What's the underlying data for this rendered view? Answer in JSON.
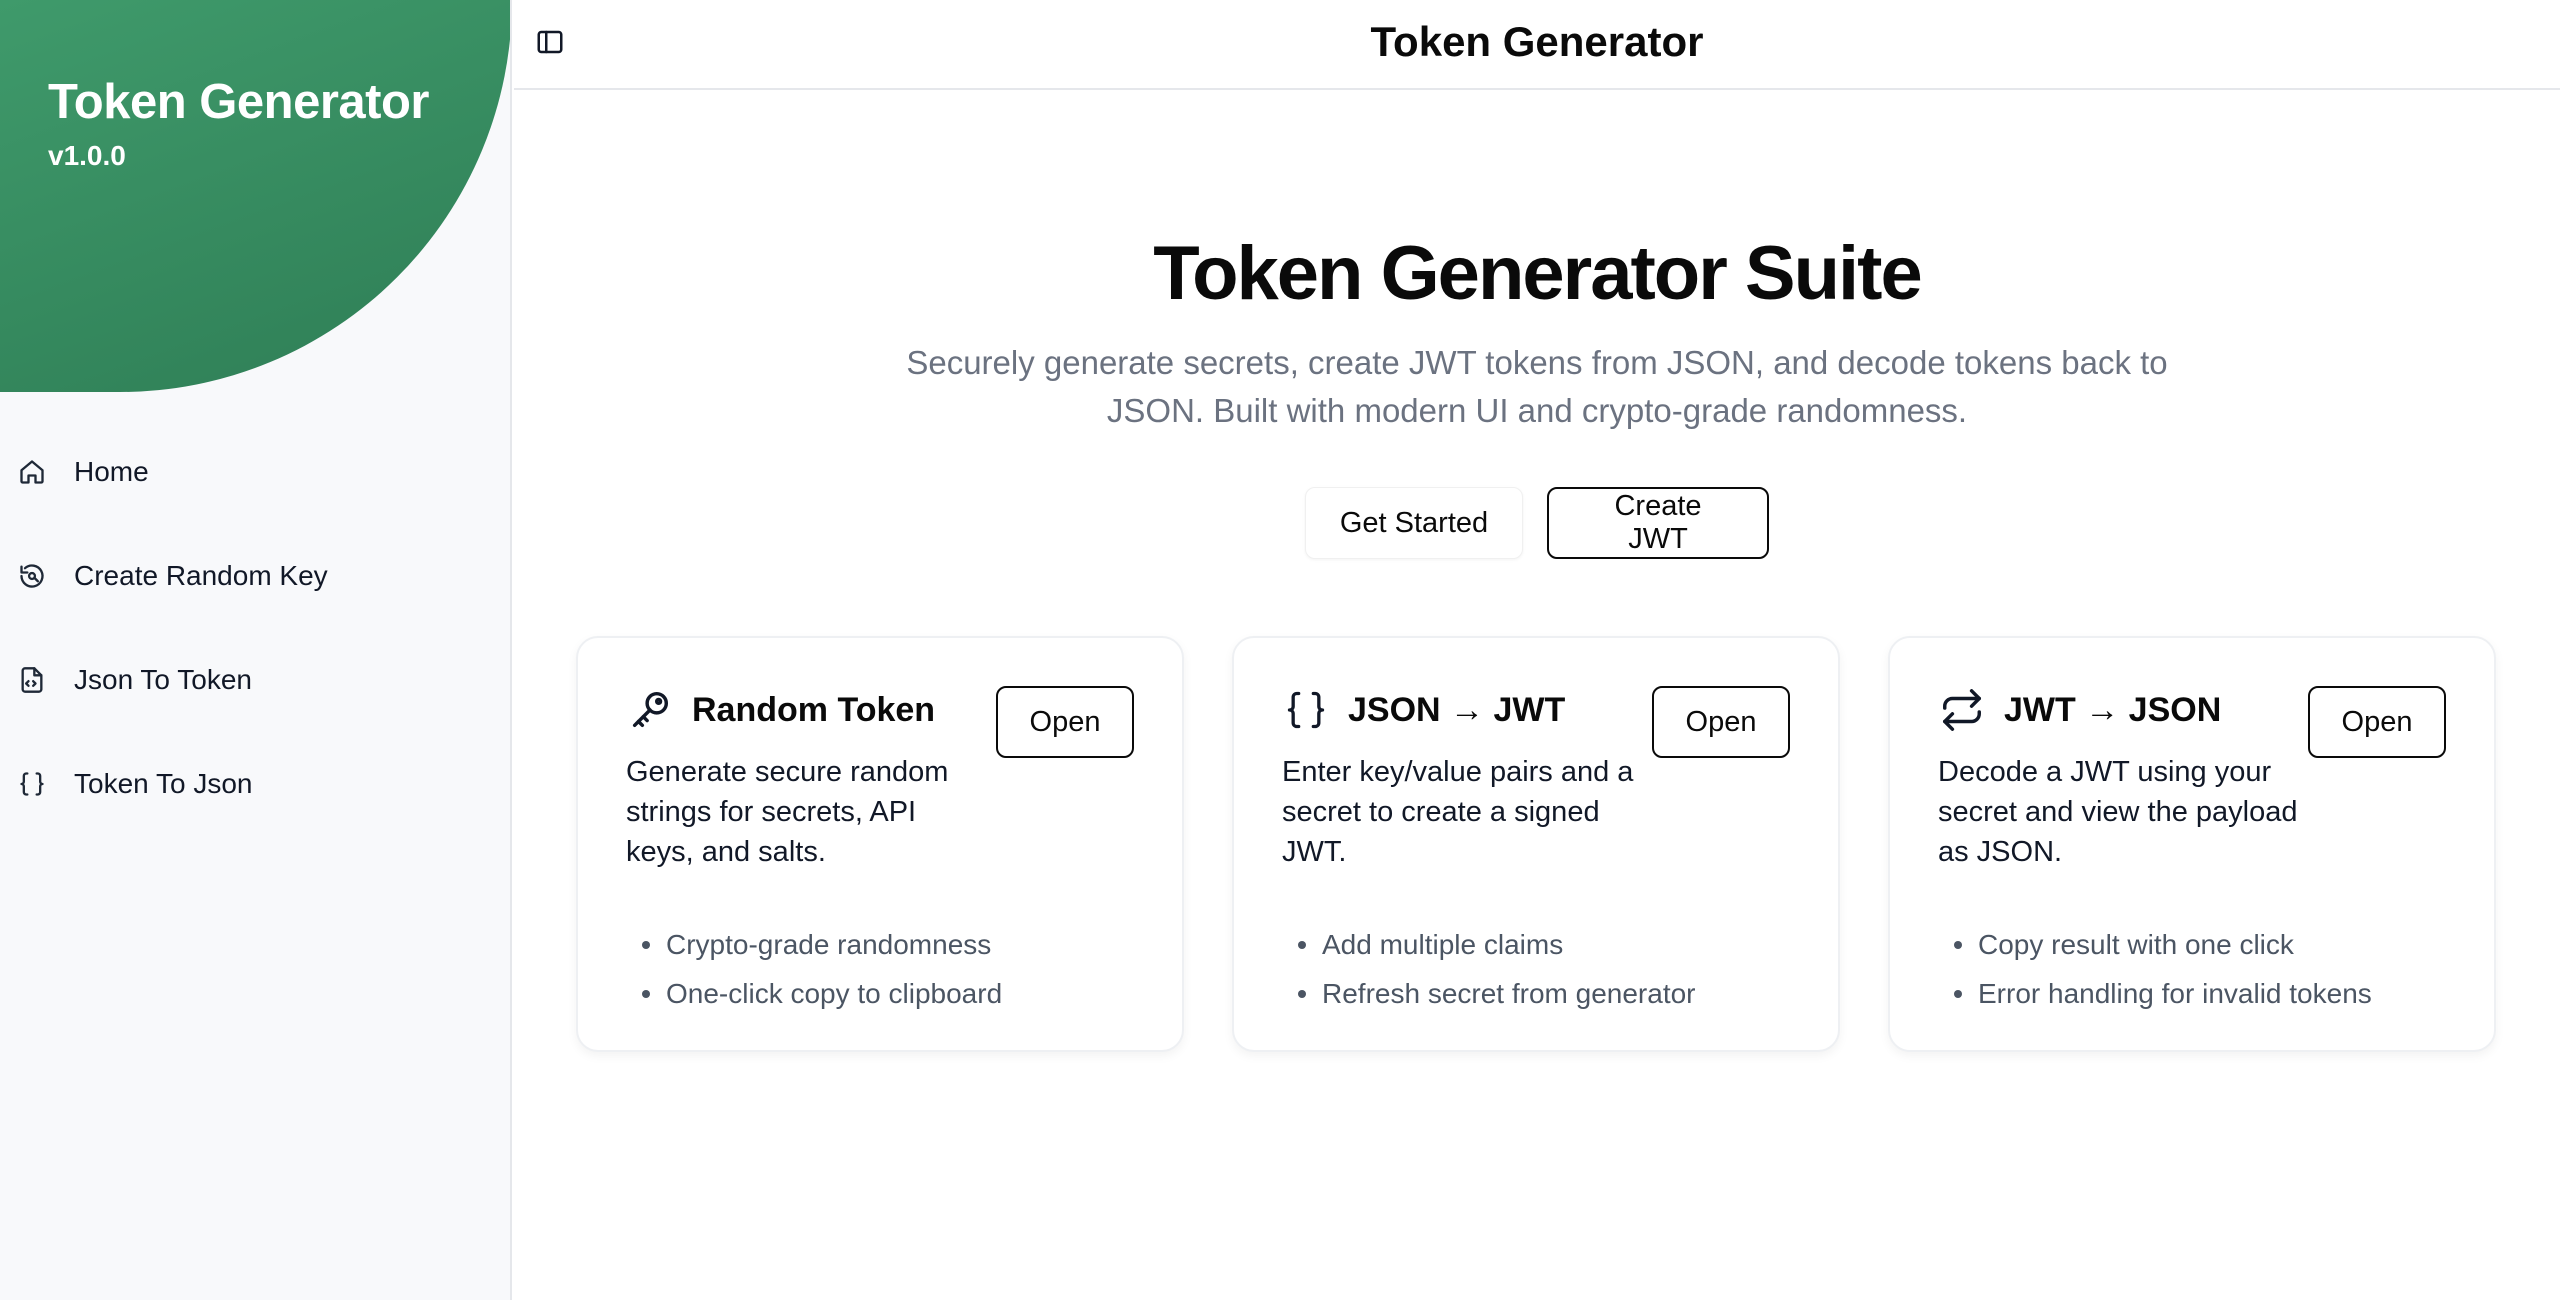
{
  "sidebar": {
    "brand_title": "Token Generator",
    "brand_version": "v1.0.0",
    "brand_color": "#3f9a6b",
    "items": [
      {
        "label": "Home",
        "icon": "home-icon"
      },
      {
        "label": "Create Random Key",
        "icon": "refresh-key-icon"
      },
      {
        "label": "Json To Token",
        "icon": "file-json-icon"
      },
      {
        "label": "Token To Json",
        "icon": "braces-icon"
      }
    ]
  },
  "header": {
    "title": "Token Generator",
    "toggle_icon": "sidebar-toggle-icon"
  },
  "hero": {
    "title": "Token Generator Suite",
    "subtitle": "Securely generate secrets, create JWT tokens from JSON, and decode tokens back to JSON. Built with modern UI and crypto-grade randomness.",
    "primary_label": "Get Started",
    "secondary_label": "Create JWT"
  },
  "cards": [
    {
      "icon": "key-icon",
      "title": "Random Token",
      "description": "Generate secure random strings for secrets, API keys, and salts.",
      "open_label": "Open",
      "features": [
        "Crypto-grade randomness",
        "One-click copy to clipboard"
      ]
    },
    {
      "icon": "braces-icon",
      "title": "JSON → JWT",
      "description": "Enter key/value pairs and a secret to create a signed JWT.",
      "open_label": "Open",
      "features": [
        "Add multiple claims",
        "Refresh secret from generator"
      ]
    },
    {
      "icon": "swap-arrows-icon",
      "title": "JWT → JSON",
      "description": "Decode a JWT using your secret and view the payload as JSON.",
      "open_label": "Open",
      "features": [
        "Copy result with one click",
        "Error handling for invalid tokens"
      ]
    }
  ]
}
